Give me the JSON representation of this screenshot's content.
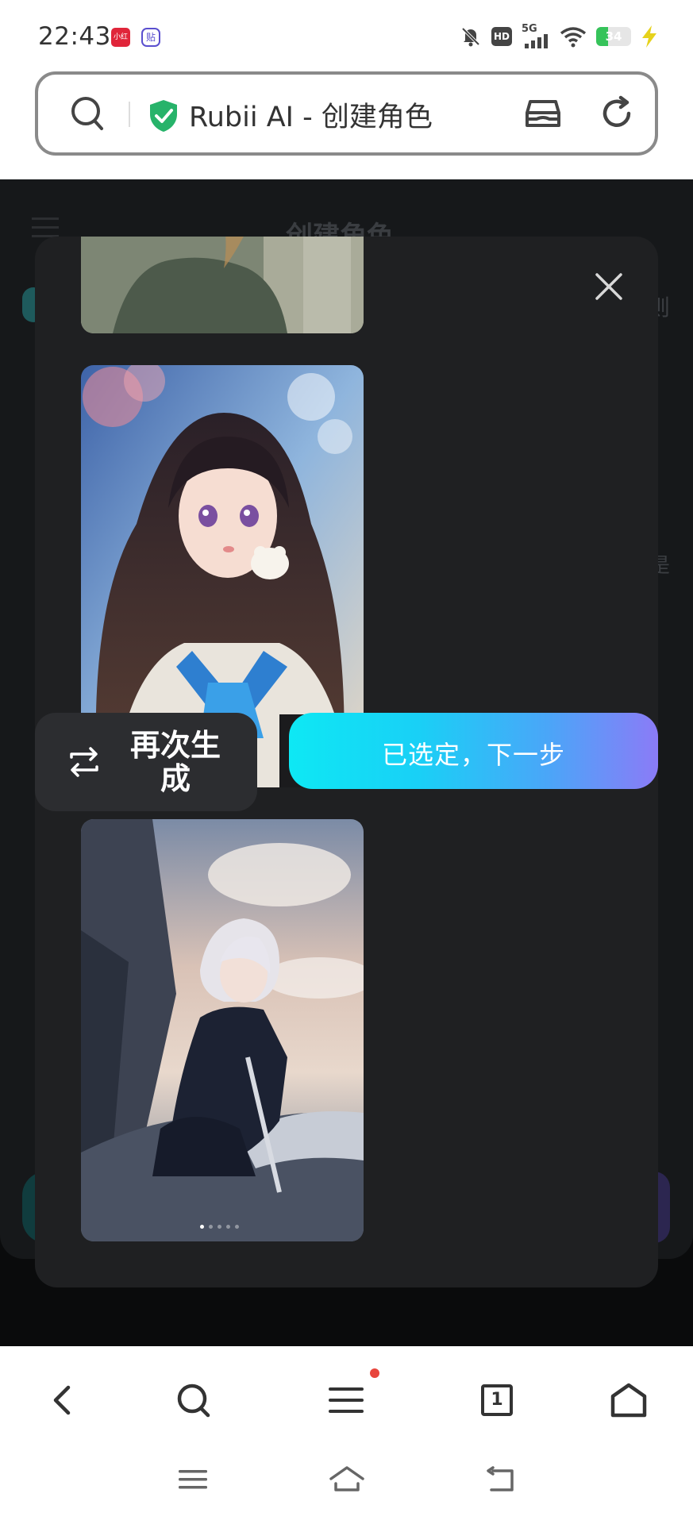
{
  "status_bar": {
    "time": "22:43",
    "app_badges": [
      "小红书",
      "贴"
    ],
    "network": "5G",
    "hd": "HD",
    "battery": "34",
    "battery_level": 0.34
  },
  "address_bar": {
    "title": "Rubii AI - 创建角色"
  },
  "background_page": {
    "title": "创建角色",
    "edge_text_1": "则",
    "edge_text_2": "是"
  },
  "modal": {
    "regenerate_label": "再次生成",
    "next_label": "已选定，下一步"
  },
  "toolbar": {
    "tab_count": "1"
  },
  "colors": {
    "accent_gradient_start": "#0ee8f4",
    "accent_gradient_end": "#8b7bf7",
    "modal_bg": "#1f2022",
    "notification_dot": "#e8453c"
  }
}
